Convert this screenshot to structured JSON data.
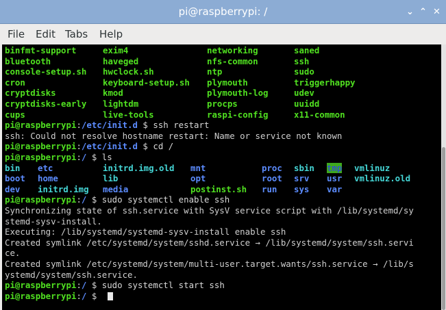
{
  "window": {
    "title": "pi@raspberrypi: /",
    "buttons": {
      "minimize": "⌄",
      "maximize": "⌃",
      "close": "✕"
    }
  },
  "menubar": {
    "items": [
      "File",
      "Edit",
      "Tabs",
      "Help"
    ]
  },
  "colors": {
    "titlebar": "#8cacd4",
    "terminal_bg": "#000000",
    "prompt_green": "#50e020",
    "dir_blue": "#5c8cff",
    "link_cyan": "#45d6d6"
  },
  "terminal": {
    "prompt_user": "pi@raspberrypi",
    "initd_listing": [
      [
        "binfmt-support",
        "exim4",
        "networking",
        "saned"
      ],
      [
        "bluetooth",
        "haveged",
        "nfs-common",
        "ssh"
      ],
      [
        "console-setup.sh",
        "hwclock.sh",
        "ntp",
        "sudo"
      ],
      [
        "cron",
        "keyboard-setup.sh",
        "plymouth",
        "triggerhappy"
      ],
      [
        "cryptdisks",
        "kmod",
        "plymouth-log",
        "udev"
      ],
      [
        "cryptdisks-early",
        "lightdm",
        "procps",
        "uuidd"
      ],
      [
        "cups",
        "live-tools",
        "raspi-config",
        "x11-common"
      ]
    ],
    "cmd1": {
      "path": "/etc/init.d",
      "command": "ssh restart"
    },
    "cmd1_output": "ssh: Could not resolve hostname restart: Name or service not known",
    "cmd2": {
      "path": "/etc/init.d",
      "command": "cd /"
    },
    "cmd3": {
      "path": "/",
      "command": "ls"
    },
    "ls_listing": [
      [
        "bin",
        "etc",
        "initrd.img.old",
        "mnt",
        "proc",
        "sbin",
        "tmp",
        "vmlinuz"
      ],
      [
        "boot",
        "home",
        "lib",
        "opt",
        "root",
        "srv",
        "usr",
        "vmlinuz.old"
      ],
      [
        "dev",
        "initrd.img",
        "media",
        "postinst.sh",
        "run",
        "sys",
        "var",
        ""
      ]
    ],
    "cmd4": {
      "path": "/",
      "command": "sudo systemctl enable ssh"
    },
    "cmd4_output": [
      "Synchronizing state of ssh.service with SysV service script with /lib/systemd/sy",
      "stemd-sysv-install.",
      "Executing: /lib/systemd/systemd-sysv-install enable ssh",
      "Created symlink /etc/systemd/system/sshd.service → /lib/systemd/system/ssh.servi",
      "ce.",
      "Created symlink /etc/systemd/system/multi-user.target.wants/ssh.service → /lib/s",
      "ystemd/system/ssh.service."
    ],
    "cmd5": {
      "path": "/",
      "command": "sudo systemctl start ssh"
    },
    "cmd6": {
      "path": "/",
      "command": ""
    }
  }
}
